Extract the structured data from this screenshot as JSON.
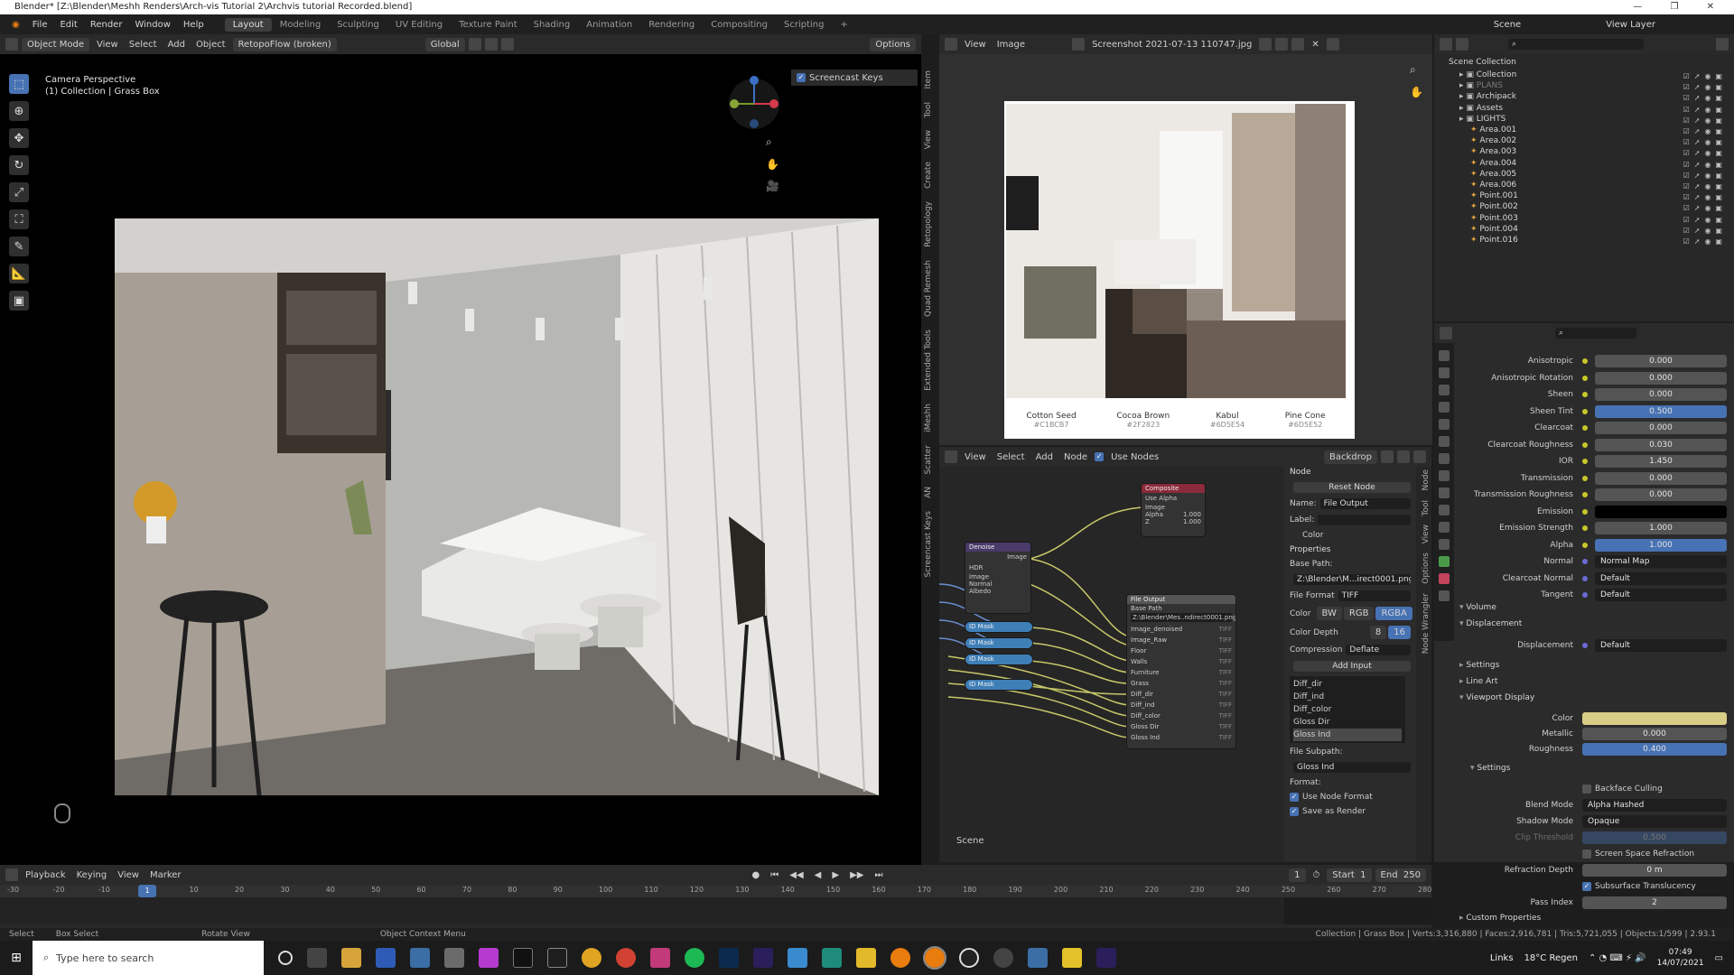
{
  "window": {
    "title": "Blender* [Z:\\Blender\\Meshh Renders\\Arch-vis Tutorial 2\\Archvis tutorial Recorded.blend]",
    "controls": [
      "—",
      "❐",
      "✕"
    ]
  },
  "menu": {
    "items": [
      "File",
      "Edit",
      "Render",
      "Window",
      "Help"
    ],
    "workspaces": [
      "Layout",
      "Modeling",
      "Sculpting",
      "UV Editing",
      "Texture Paint",
      "Shading",
      "Animation",
      "Rendering",
      "Compositing",
      "Scripting"
    ],
    "active_workspace": "Layout",
    "scene_label": "Scene",
    "view_layer_label": "View Layer"
  },
  "viewport": {
    "mode": "Object Mode",
    "menus": [
      "View",
      "Select",
      "Add",
      "Object"
    ],
    "addon": "RetopoFlow (broken)",
    "orientation": "Global",
    "options": "Options",
    "info_line1": "Camera Perspective",
    "info_line2": "(1) Collection | Grass Box",
    "screencast_label": "Screencast Keys",
    "side_tabs": [
      "Item",
      "Tool",
      "View",
      "Create",
      "Retopology",
      "Quad Remesh",
      "Extended Tools",
      "iMeshh",
      "Scatter",
      "AN",
      "Screencast Keys"
    ]
  },
  "image_editor": {
    "menus": [
      "View",
      "Image"
    ],
    "image_name": "Screenshot 2021-07-13 110747.jpg",
    "swatches": [
      {
        "name": "Cotton Seed",
        "hex": "#C1BCB7",
        "color": "#c1bcb7"
      },
      {
        "name": "Cocoa Brown",
        "hex": "#2F2823",
        "color": "#2f2823"
      },
      {
        "name": "Kabul",
        "hex": "#6D5E54",
        "color": "#6d5e54"
      },
      {
        "name": "Pine Cone",
        "hex": "#6D5E52",
        "color": "#6d5e52"
      }
    ]
  },
  "node_editor": {
    "menus": [
      "View",
      "Select",
      "Add",
      "Node"
    ],
    "use_nodes_label": "Use Nodes",
    "backdrop_label": "Backdrop",
    "scene_label": "Scene",
    "composite_node": {
      "title": "Composite",
      "use_alpha": "Use Alpha",
      "inputs": [
        "Image",
        "Alpha",
        "Z"
      ],
      "alpha_value": "1.000",
      "z_value": "1.000"
    },
    "denoise_node": {
      "title": "Denoise",
      "output": "Image",
      "hdr": "HDR",
      "inputs": [
        "Image",
        "Normal",
        "Albedo"
      ]
    },
    "id_mask_nodes": [
      "ID Mask",
      "ID Mask",
      "ID Mask",
      "ID Mask"
    ],
    "file_output_node": {
      "title": "File Output",
      "base_path_label": "Base Path",
      "path": "Z:\\Blender\\Mes..ndirect0001.png",
      "inputs": [
        "Image_denoised",
        "Image_Raw",
        "Floor",
        "Walls",
        "Furniture",
        "Grass",
        "Diff_dir",
        "Diff_ind",
        "Diff_color",
        "Gloss Dir",
        "Gloss Ind"
      ],
      "format_tag": "TIFF"
    }
  },
  "node_panel": {
    "tabs": [
      "Node",
      "Tool",
      "View",
      "Options",
      "Node Wrangler"
    ],
    "section_node": "Node",
    "reset_node": "Reset Node",
    "name_label": "Name:",
    "name_value": "File Output",
    "label_label": "Label:",
    "color_label": "Color",
    "properties_label": "Properties",
    "base_path_label": "Base Path:",
    "base_path_value": "Z:\\Blender\\M...irect0001.png",
    "file_format_label": "File Format",
    "file_format_value": "TIFF",
    "color_label2": "Color",
    "color_modes": [
      "BW",
      "RGB",
      "RGBA"
    ],
    "color_depth_label": "Color Depth",
    "color_depths": [
      "8",
      "16"
    ],
    "compression_label": "Compression",
    "compression_value": "Deflate",
    "add_input": "Add Input",
    "inputs_list": [
      "Diff_dir",
      "Diff_ind",
      "Diff_color",
      "Gloss Dir",
      "Gloss Ind"
    ],
    "selected_input": "Gloss Ind",
    "file_subpath_label": "File Subpath:",
    "file_subpath_value": "Gloss Ind",
    "format_label": "Format:",
    "use_node_format": "Use Node Format",
    "save_as_render": "Save as Render"
  },
  "outliner": {
    "root": "Scene Collection",
    "items": [
      {
        "name": "Collection",
        "indent": 1,
        "color": "#d7d7d7"
      },
      {
        "name": "PLANS",
        "indent": 1,
        "color": "#7a7a7a"
      },
      {
        "name": "Archipack",
        "indent": 1,
        "color": "#d7d7d7"
      },
      {
        "name": "Assets",
        "indent": 1,
        "color": "#d7d7d7"
      },
      {
        "name": "LIGHTS",
        "indent": 1,
        "color": "#d7d7d7"
      },
      {
        "name": "Area.001",
        "indent": 2,
        "color": "#d7d7d7"
      },
      {
        "name": "Area.002",
        "indent": 2,
        "color": "#d7d7d7"
      },
      {
        "name": "Area.003",
        "indent": 2,
        "color": "#d7d7d7"
      },
      {
        "name": "Area.004",
        "indent": 2,
        "color": "#d7d7d7"
      },
      {
        "name": "Area.005",
        "indent": 2,
        "color": "#d7d7d7"
      },
      {
        "name": "Area.006",
        "indent": 2,
        "color": "#d7d7d7"
      },
      {
        "name": "Point.001",
        "indent": 2,
        "color": "#d7d7d7"
      },
      {
        "name": "Point.002",
        "indent": 2,
        "color": "#d7d7d7"
      },
      {
        "name": "Point.003",
        "indent": 2,
        "color": "#d7d7d7"
      },
      {
        "name": "Point.004",
        "indent": 2,
        "color": "#d7d7d7"
      },
      {
        "name": "Point.016",
        "indent": 2,
        "color": "#d7d7d7"
      }
    ]
  },
  "properties": {
    "rows": [
      {
        "label": "Anisotropic",
        "value": "0.000",
        "style": ""
      },
      {
        "label": "Anisotropic Rotation",
        "value": "0.000",
        "style": ""
      },
      {
        "label": "Sheen",
        "value": "0.000",
        "style": ""
      },
      {
        "label": "Sheen Tint",
        "value": "0.500",
        "style": "blue"
      },
      {
        "label": "Clearcoat",
        "value": "0.000",
        "style": ""
      },
      {
        "label": "Clearcoat Roughness",
        "value": "0.030",
        "style": ""
      },
      {
        "label": "IOR",
        "value": "1.450",
        "style": ""
      },
      {
        "label": "Transmission",
        "value": "0.000",
        "style": ""
      },
      {
        "label": "Transmission Roughness",
        "value": "0.000",
        "style": ""
      },
      {
        "label": "Emission",
        "value": "",
        "style": "black"
      },
      {
        "label": "Emission Strength",
        "value": "1.000",
        "style": ""
      },
      {
        "label": "Alpha",
        "value": "1.000",
        "style": "blue"
      },
      {
        "label": "Normal",
        "value": "Normal Map",
        "style": "dark"
      },
      {
        "label": "Clearcoat Normal",
        "value": "Default",
        "style": "dark"
      },
      {
        "label": "Tangent",
        "value": "Default",
        "style": "dark"
      }
    ],
    "sections": [
      "Volume",
      "Displacement",
      "Settings",
      "Line Art",
      "Viewport Display",
      "Settings",
      "Custom Properties"
    ],
    "displacement_label": "Displacement",
    "displacement_value": "Default",
    "viewport_display": [
      {
        "label": "Color",
        "value": "",
        "style": "yellow"
      },
      {
        "label": "Metallic",
        "value": "0.000",
        "style": ""
      },
      {
        "label": "Roughness",
        "value": "0.400",
        "style": "blue"
      }
    ],
    "settings": {
      "backface_culling": "Backface Culling",
      "blend_mode_label": "Blend Mode",
      "blend_mode_value": "Alpha Hashed",
      "shadow_mode_label": "Shadow Mode",
      "shadow_mode_value": "Opaque",
      "clip_threshold_label": "Clip Threshold",
      "clip_threshold_value": "0.500",
      "screen_space_refraction": "Screen Space Refraction",
      "refraction_depth_label": "Refraction Depth",
      "refraction_depth_value": "0 m",
      "subsurface_translucency": "Subsurface Translucency",
      "pass_index_label": "Pass Index",
      "pass_index_value": "2"
    }
  },
  "timeline": {
    "menus": [
      "Playback",
      "Keying",
      "View",
      "Marker"
    ],
    "current_frame": "1",
    "start_label": "Start",
    "start": "1",
    "end_label": "End",
    "end": "250",
    "ticks": [
      "-30",
      "-20",
      "-10",
      "0",
      "10",
      "20",
      "30",
      "40",
      "50",
      "60",
      "70",
      "80",
      "90",
      "100",
      "110",
      "120",
      "130",
      "140",
      "150",
      "160",
      "170",
      "180",
      "190",
      "200",
      "210",
      "220",
      "230",
      "240",
      "250",
      "260",
      "270",
      "280"
    ]
  },
  "status": {
    "select": "Select",
    "box_select": "Box Select",
    "rotate_view": "Rotate View",
    "context_menu": "Object Context Menu",
    "stats": "Collection | Grass Box | Verts:3,316,880 | Faces:2,916,781 | Tris:5,721,055 | Objects:1/599 | 2.93.1"
  },
  "taskbar": {
    "search_placeholder": "Type here to search",
    "links": "Links",
    "weather": "18°C Regen",
    "time": "07:49",
    "date": "14/07/2021"
  }
}
